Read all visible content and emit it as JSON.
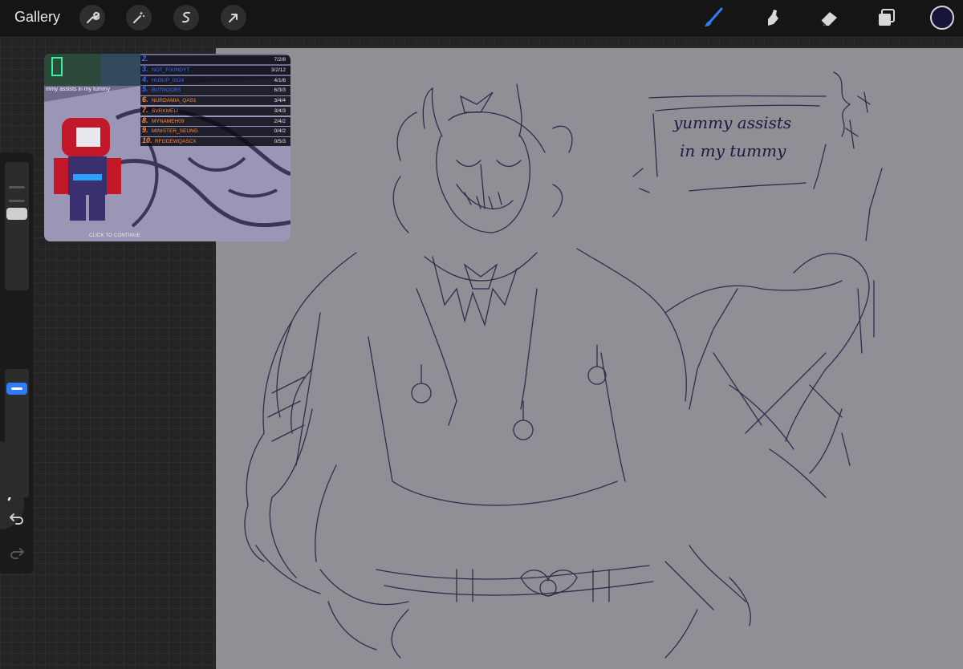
{
  "topbar": {
    "gallery_label": "Gallery",
    "left_icons": [
      "wrench-icon",
      "magic-wand-icon",
      "selection-icon",
      "transform-arrow-icon"
    ],
    "right_tools": [
      "brush-icon",
      "smudge-icon",
      "eraser-icon",
      "layers-icon"
    ],
    "active_tool": "brush",
    "current_color": "#16163a",
    "accent": "#2f7df6"
  },
  "sidebar": {
    "icons": [
      "undo-icon",
      "redo-icon"
    ]
  },
  "reference": {
    "chat_text": "mmy assists in my tummy",
    "click_text": "CLICK TO CONTINUE",
    "leaderboard": [
      {
        "rank": "2.",
        "name": "",
        "score": "7/2/8",
        "name_color": "#2d5bff",
        "rank_color": "#4a6dff"
      },
      {
        "rank": "3.",
        "name": "NOT_F0UNDYT",
        "score": "3/2/12",
        "name_color": "#3a6bff",
        "rank_color": "#3a6bff"
      },
      {
        "rank": "4.",
        "name": "HU3UP_0324",
        "score": "4/1/6",
        "name_color": "#3a6bff",
        "rank_color": "#3a6bff"
      },
      {
        "rank": "5.",
        "name": "BUTNOOBS",
        "score": "6/3/3",
        "name_color": "#3a6bff",
        "rank_color": "#3a6bff"
      },
      {
        "rank": "6.",
        "name": "NURDAMIA_QAS1",
        "score": "3/4/4",
        "name_color": "#ff8a3a",
        "rank_color": "#ff8a3a"
      },
      {
        "rank": "7.",
        "name": "SVRKMELI",
        "score": "3/4/3",
        "name_color": "#ff8a3a",
        "rank_color": "#ff8a3a"
      },
      {
        "rank": "8.",
        "name": "MYNAMEH09",
        "score": "2/4/2",
        "name_color": "#ff8a3a",
        "rank_color": "#ff8a3a"
      },
      {
        "rank": "9.",
        "name": "MINISTER_SEUNG",
        "score": "0/4/2",
        "name_color": "#ff8a3a",
        "rank_color": "#ff8a3a"
      },
      {
        "rank": "10.",
        "name": "RFGDEWQASCX",
        "score": "0/5/3",
        "name_color": "#ff8a3a",
        "rank_color": "#ff8a3a"
      }
    ]
  },
  "canvas": {
    "speech_text_line1": "yummy assists",
    "speech_text_line2": "in my tummy",
    "sketch_color": "#1a1a3e",
    "paper_color": "#8f8f96"
  }
}
